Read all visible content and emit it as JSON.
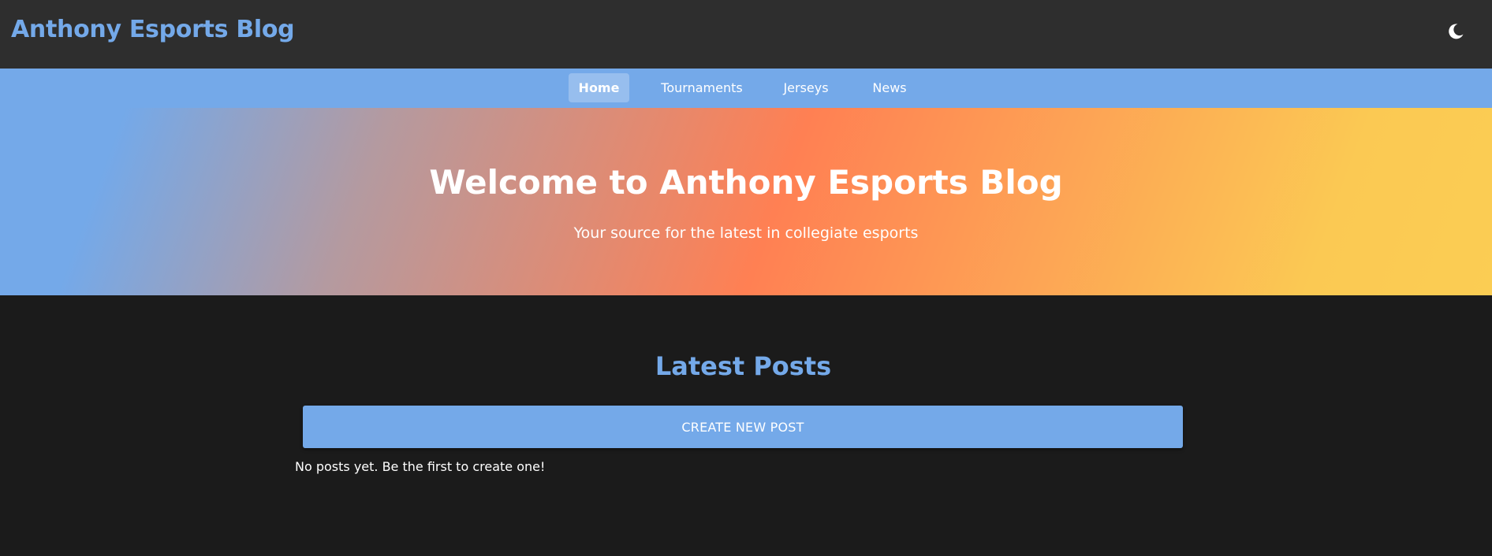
{
  "header": {
    "site_title": "Anthony Esports Blog",
    "theme_toggle_icon": "moon-icon"
  },
  "nav": {
    "items": [
      {
        "label": "Home",
        "active": true
      },
      {
        "label": "Tournaments",
        "active": false
      },
      {
        "label": "Jerseys",
        "active": false
      },
      {
        "label": "News",
        "active": false
      }
    ]
  },
  "hero": {
    "title": "Welcome to Anthony Esports Blog",
    "subtitle": "Your source for the latest in collegiate esports"
  },
  "posts": {
    "section_title": "Latest Posts",
    "create_button_label": "CREATE NEW POST",
    "empty_message": "No posts yet. Be the first to create one!"
  },
  "colors": {
    "accent": "#74a9e9",
    "topbar_bg": "#2e2e2e",
    "page_bg": "#1b1b1b",
    "hero_gradient": [
      "#74a9e9",
      "#ff8053",
      "#fbcd53"
    ]
  }
}
